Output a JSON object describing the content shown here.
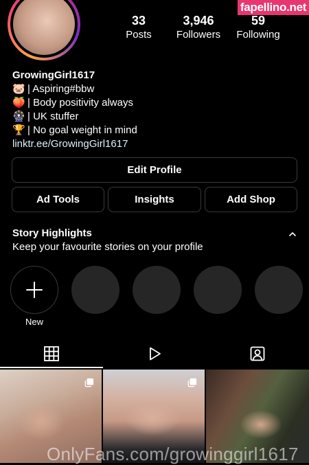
{
  "watermark_badge": "fapellino.net",
  "stats": {
    "posts": {
      "value": "33",
      "label": "Posts"
    },
    "followers": {
      "value": "3,946",
      "label": "Followers"
    },
    "following": {
      "value": "59",
      "label": "Following"
    }
  },
  "profile": {
    "username": "GrowingGirl1617",
    "bio": [
      {
        "emoji": "🐷",
        "text": "| Aspiring#bbw"
      },
      {
        "emoji": "🍑",
        "text": "| Body positivity always"
      },
      {
        "emoji": "🎡",
        "text": "| UK stuffer"
      },
      {
        "emoji": "🏆",
        "text": "| No goal weight in mind"
      }
    ],
    "link": "linktr.ee/GrowingGirl1617"
  },
  "buttons": {
    "edit_profile": "Edit Profile",
    "ad_tools": "Ad Tools",
    "insights": "Insights",
    "add_shop": "Add Shop"
  },
  "story_highlights": {
    "title": "Story Highlights",
    "subtitle": "Keep your favourite stories on your profile",
    "new_label": "New"
  },
  "tabs": [
    "grid-icon",
    "reels-icon",
    "tagged-icon"
  ],
  "footer_watermark": "OnlyFans.com/growinggirl1617"
}
